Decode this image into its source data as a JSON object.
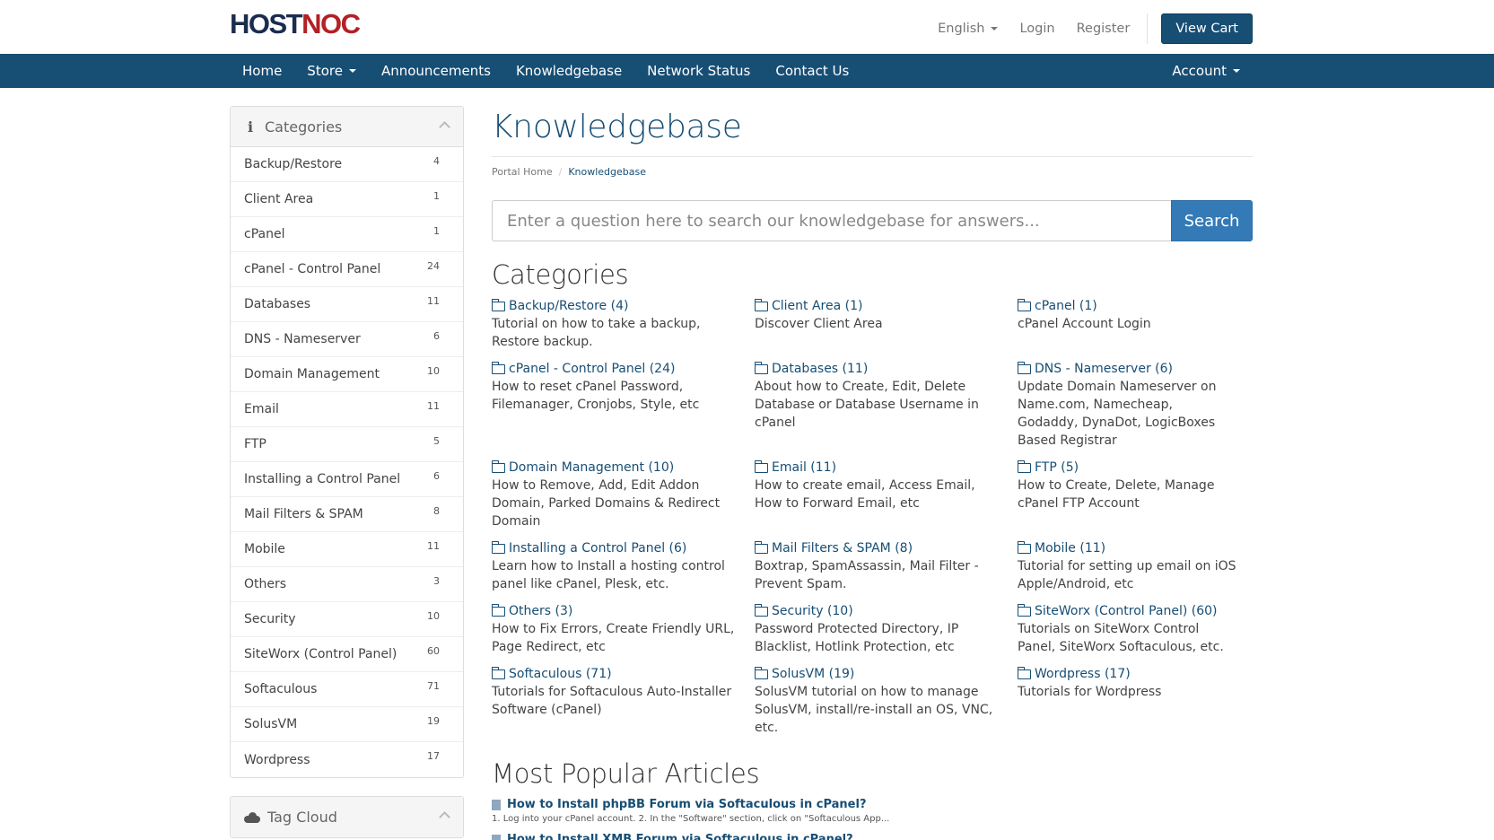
{
  "brand": {
    "logo_a": "HOST",
    "logo_b": "NOC"
  },
  "topbar": {
    "language": "English",
    "login": "Login",
    "register": "Register",
    "cart": "View Cart"
  },
  "nav": {
    "items": [
      "Home",
      "Store",
      "Announcements",
      "Knowledgebase",
      "Network Status",
      "Contact Us"
    ],
    "account": "Account"
  },
  "sidebar": {
    "categories_title": "Categories",
    "categories": [
      {
        "label": "Backup/Restore",
        "count": "4"
      },
      {
        "label": "Client Area",
        "count": "1"
      },
      {
        "label": "cPanel",
        "count": "1"
      },
      {
        "label": "cPanel - Control Panel",
        "count": "24"
      },
      {
        "label": "Databases",
        "count": "11"
      },
      {
        "label": "DNS - Nameserver",
        "count": "6"
      },
      {
        "label": "Domain Management",
        "count": "10"
      },
      {
        "label": "Email",
        "count": "11"
      },
      {
        "label": "FTP",
        "count": "5"
      },
      {
        "label": "Installing a Control Panel",
        "count": "6"
      },
      {
        "label": "Mail Filters & SPAM",
        "count": "8"
      },
      {
        "label": "Mobile",
        "count": "11"
      },
      {
        "label": "Others",
        "count": "3"
      },
      {
        "label": "Security",
        "count": "10"
      },
      {
        "label": "SiteWorx (Control Panel)",
        "count": "60"
      },
      {
        "label": "Softaculous",
        "count": "71"
      },
      {
        "label": "SolusVM",
        "count": "19"
      },
      {
        "label": "Wordpress",
        "count": "17"
      }
    ],
    "tagcloud_title": "Tag Cloud"
  },
  "main": {
    "title": "Knowledgebase",
    "breadcrumb": {
      "home": "Portal Home",
      "current": "Knowledgebase"
    },
    "search": {
      "placeholder": "Enter a question here to search our knowledgebase for answers...",
      "button": "Search"
    },
    "categories_heading": "Categories",
    "categories": [
      {
        "title": "Backup/Restore (4)",
        "desc": "Tutorial on how to take a backup, Restore backup."
      },
      {
        "title": "Client Area (1)",
        "desc": "Discover Client Area"
      },
      {
        "title": "cPanel (1)",
        "desc": "cPanel Account Login"
      },
      {
        "title": "cPanel - Control Panel (24)",
        "desc": "How to reset cPanel Password, Filemanager, Cronjobs, Style, etc"
      },
      {
        "title": "Databases (11)",
        "desc": "About how to Create, Edit, Delete Database or Database Username in cPanel"
      },
      {
        "title": "DNS - Nameserver (6)",
        "desc": "Update Domain Nameserver on Name.com, Namecheap, Godaddy, DynaDot, LogicBoxes Based Registrar"
      },
      {
        "title": "Domain Management (10)",
        "desc": "How to Remove, Add, Edit Addon Domain, Parked Domains & Redirect Domain"
      },
      {
        "title": "Email (11)",
        "desc": "How to create email, Access Email, How to Forward Email, etc"
      },
      {
        "title": "FTP (5)",
        "desc": "How to Create, Delete, Manage cPanel FTP Account"
      },
      {
        "title": "Installing a Control Panel (6)",
        "desc": "Learn how to Install a hosting control panel like cPanel, Plesk, etc."
      },
      {
        "title": "Mail Filters & SPAM (8)",
        "desc": "Boxtrap, SpamAssassin, Mail Filter - Prevent Spam."
      },
      {
        "title": "Mobile (11)",
        "desc": "Tutorial for setting up email on iOS Apple/Android, etc"
      },
      {
        "title": "Others (3)",
        "desc": "How to Fix Errors, Create Friendly URL, Page Redirect, etc"
      },
      {
        "title": "Security (10)",
        "desc": "Password Protected Directory, IP Blacklist, Hotlink Protection, etc"
      },
      {
        "title": "SiteWorx (Control Panel) (60)",
        "desc": "Tutorials on SiteWorx Control Panel, SiteWorx Softaculous, etc."
      },
      {
        "title": "Softaculous (71)",
        "desc": "Tutorials for Softaculous Auto-Installer Software (cPanel)"
      },
      {
        "title": "SolusVM (19)",
        "desc": "SolusVM tutorial on how to manage SolusVM, install/re-install an OS, VNC, etc."
      },
      {
        "title": "Wordpress (17)",
        "desc": "Tutorials for Wordpress"
      }
    ],
    "popular_heading": "Most Popular Articles",
    "articles": [
      {
        "title": "How to Install phpBB Forum via Softaculous in cPanel?",
        "snippet": "1. Log into your cPanel account. 2. In the \"Software\" section, click on \"Softaculous App..."
      },
      {
        "title": "How to Install XMB Forum via Softaculous in cPanel?",
        "snippet": ""
      }
    ]
  },
  "colors": {
    "brand_blue": "#174e74",
    "brand_red": "#b32025",
    "search_button": "#337ab7"
  }
}
